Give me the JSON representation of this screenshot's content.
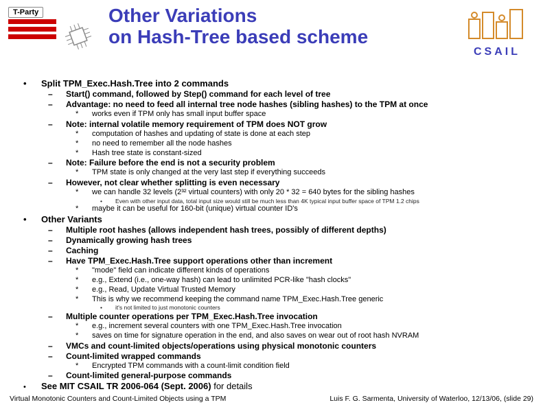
{
  "header": {
    "tparty_label": "T-Party",
    "title_line1": "Other Variations",
    "title_line2": "on Hash-Tree based scheme",
    "csail": "CSAIL"
  },
  "items": {
    "p1": "Split TPM_Exec.Hash.Tree into 2 commands",
    "p1a": "Start() command, followed by Step() command for each level of tree",
    "p1b": "Advantage: no need to feed all internal tree node hashes (sibling hashes) to the TPM at once",
    "p1b1": "works even if TPM only has small input buffer space",
    "p1c": "Note: internal volatile memory requirement of TPM does NOT grow",
    "p1c1": "computation of hashes and updating of state is done at each step",
    "p1c2": "no need to remember all the node hashes",
    "p1c3": "Hash tree state is constant-sized",
    "p1d": "Note: Failure before the end is not a security problem",
    "p1d1": "TPM state is only changed at the very last step if everything succeeds",
    "p1e": "However, not clear whether splitting is even necessary",
    "p1e1": "we can handle 32 levels (2³² virtual counters) with only 20 * 32 = 640 bytes for the sibling hashes",
    "p1e1a": "Even with other input data, total input size would still be much less than 4K typical input buffer space of TPM 1.2 chips",
    "p1e2": "maybe it can be useful for 160-bit (unique) virtual counter ID's",
    "p2": "Other Variants",
    "p2a": "Multiple root hashes (allows independent hash trees, possibly of different depths)",
    "p2b": "Dynamically growing hash trees",
    "p2c": "Caching",
    "p2d": "Have TPM_Exec.Hash.Tree support operations other than increment",
    "p2d1": "\"mode\" field can indicate different kinds of operations",
    "p2d2": "e.g., Extend (i.e., one-way hash) can lead to unlimited PCR-like \"hash clocks\"",
    "p2d3": "e.g., Read, Update Virtual Trusted Memory",
    "p2d4": "This is why we recommend keeping the command name TPM_Exec.Hash.Tree generic",
    "p2d4a": "it's not limited to just monotonic counters",
    "p2e": "Multiple counter operations per TPM_Exec.Hash.Tree invocation",
    "p2e1": "e.g., increment several counters with one TPM_Exec.Hash.Tree invocation",
    "p2e2": "saves on time for signature operation in the end, and also saves on wear out of root hash NVRAM",
    "p2f": "VMCs and count-limited objects/operations using physical monotonic counters",
    "p2g": "Count-limited wrapped commands",
    "p2g1": "Encrypted TPM commands with a count-limit condition field",
    "p2h": "Count-limited general-purpose commands",
    "p3a": "See MIT CSAIL TR 2006-064 (Sept. 2006) ",
    "p3b": "for details"
  },
  "footer": {
    "left": "Virtual Monotonic Counters and Count-Limited Objects using a TPM",
    "right": "Luis F. G. Sarmenta, University of Waterloo, 12/13/06, (slide 29)"
  }
}
